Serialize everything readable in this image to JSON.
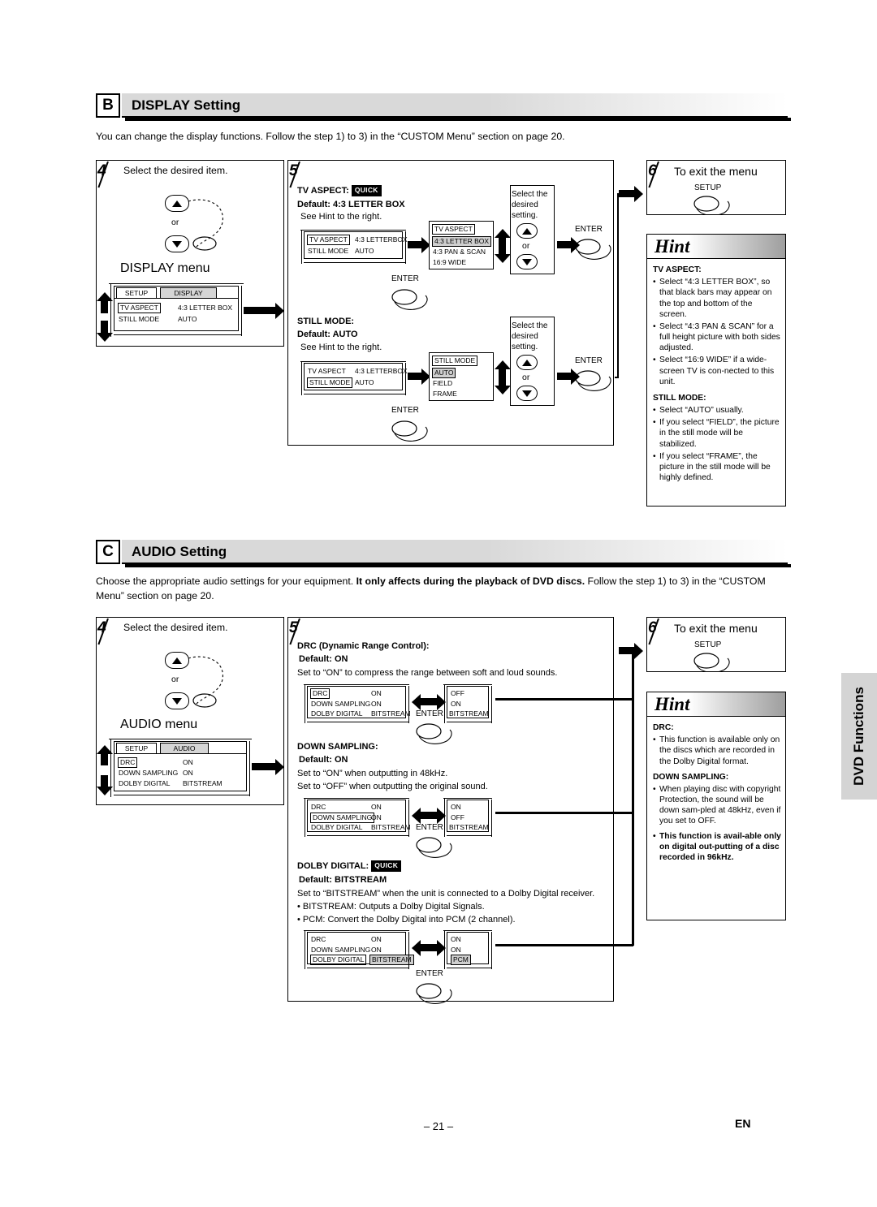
{
  "page": {
    "number": "– 21 –",
    "lang": "EN",
    "side_tab": "DVD Functions"
  },
  "sections": [
    {
      "letter": "B",
      "title": "DISPLAY Setting",
      "intro": "You can change the display functions. Follow the step 1) to 3) in the “CUSTOM Menu” section on page 20.",
      "step4": {
        "num": "4",
        "label": "Select the desired item.",
        "or": "or",
        "menu_label": "DISPLAY menu"
      },
      "step5": {
        "num": "5"
      },
      "step6": {
        "num": "6",
        "label": "To exit the menu",
        "setup": "SETUP"
      },
      "osd_main": {
        "tab_left": "SETUP",
        "tab_right": "DISPLAY",
        "rows": [
          {
            "name": "TV ASPECT",
            "value": "4:3 LETTER BOX"
          },
          {
            "name": "STILL MODE",
            "value": "AUTO"
          }
        ]
      },
      "items": [
        {
          "title": "TV ASPECT:",
          "quick": "QUICK",
          "default": "Default: 4:3 LETTER BOX",
          "note": "See Hint to the right.",
          "osd_before": {
            "rows": [
              {
                "name": "TV ASPECT",
                "value": "4:3 LETTERBOX"
              },
              {
                "name": "STILL MODE",
                "value": "AUTO"
              }
            ]
          },
          "enter": "ENTER",
          "select_note": "Select the desired setting.",
          "options": [
            "TV ASPECT",
            "4:3 LETTER BOX",
            "4:3 PAN & SCAN",
            "16:9 WIDE"
          ],
          "or": "or",
          "enter2": "ENTER"
        },
        {
          "title": "STILL MODE:",
          "quick": "",
          "default": "Default: AUTO",
          "note": "See Hint to the right.",
          "osd_before": {
            "rows": [
              {
                "name": "TV ASPECT",
                "value": "4:3 LETTERBOX"
              },
              {
                "name": "STILL MODE",
                "value": "AUTO"
              }
            ]
          },
          "enter": "ENTER",
          "select_note": "Select the desired setting.",
          "options": [
            "STILL MODE",
            "AUTO",
            "FIELD",
            "FRAME"
          ],
          "or": "or",
          "enter2": "ENTER"
        }
      ],
      "hint": {
        "word": "Hint",
        "groups": [
          {
            "head": "TV ASPECT:",
            "bullets": [
              "Select “4:3 LETTER BOX”, so that black bars may appear on the top and bottom of the screen.",
              "Select “4:3 PAN & SCAN” for a full height picture with both sides adjusted.",
              "Select “16:9 WIDE” if a wide-screen TV is con-nected to this unit."
            ]
          },
          {
            "head": "STILL MODE:",
            "bullets": [
              "Select “AUTO” usually.",
              "If you select “FIELD”, the picture in the still mode will be stabilized.",
              "If you select “FRAME”, the picture in the still mode will be highly defined."
            ]
          }
        ]
      }
    },
    {
      "letter": "C",
      "title": "AUDIO Setting",
      "intro_pre": "Choose the appropriate audio settings for your equipment. ",
      "intro_bold": "It only affects during the playback of DVD discs.",
      "intro_post": " Follow the step 1) to 3) in the “CUSTOM Menu” section on page 20.",
      "step4": {
        "num": "4",
        "label": "Select the desired item.",
        "or": "or",
        "menu_label": "AUDIO menu"
      },
      "step5": {
        "num": "5"
      },
      "step6": {
        "num": "6",
        "label": "To exit the menu",
        "setup": "SETUP"
      },
      "osd_main": {
        "tab_left": "SETUP",
        "tab_right": "AUDIO",
        "rows": [
          {
            "name": "DRC",
            "value": "ON"
          },
          {
            "name": "DOWN SAMPLING",
            "value": "ON"
          },
          {
            "name": "DOLBY DIGITAL",
            "value": "BITSTREAM"
          }
        ]
      },
      "items": [
        {
          "title": "DRC (Dynamic Range Control):",
          "quick": "",
          "default": "Default: ON",
          "desc": [
            "Set to “ON” to compress the range between soft and loud sounds."
          ],
          "osd_left": {
            "rows": [
              {
                "name": "DRC",
                "value": "ON"
              },
              {
                "name": "DOWN SAMPLING",
                "value": "ON"
              },
              {
                "name": "DOLBY DIGITAL",
                "value": "BITSTREAM"
              }
            ]
          },
          "osd_right": {
            "rows": [
              {
                "name": "",
                "value": "OFF"
              },
              {
                "name": "",
                "value": "ON"
              },
              {
                "name": "",
                "value": "BITSTREAM"
              }
            ]
          },
          "enter": "ENTER"
        },
        {
          "title": "DOWN SAMPLING:",
          "quick": "",
          "default": "Default: ON",
          "desc": [
            "Set to “ON” when outputting in 48kHz.",
            "Set to “OFF” when outputting the original sound."
          ],
          "osd_left": {
            "rows": [
              {
                "name": "DRC",
                "value": "ON"
              },
              {
                "name": "DOWN SAMPLING",
                "value": "ON"
              },
              {
                "name": "DOLBY DIGITAL",
                "value": "BITSTREAM"
              }
            ]
          },
          "osd_right": {
            "rows": [
              {
                "name": "",
                "value": "ON"
              },
              {
                "name": "",
                "value": "OFF"
              },
              {
                "name": "",
                "value": "BITSTREAM"
              }
            ]
          },
          "enter": "ENTER"
        },
        {
          "title": "DOLBY DIGITAL:",
          "quick": "QUICK",
          "default": "Default: BITSTREAM",
          "desc": [
            "Set to “BITSTREAM” when the unit is connected to a Dolby Digital receiver.",
            "• BITSTREAM: Outputs a Dolby Digital Signals.",
            "• PCM: Convert the Dolby Digital into PCM (2 channel)."
          ],
          "osd_left": {
            "rows": [
              {
                "name": "DRC",
                "value": "ON"
              },
              {
                "name": "DOWN SAMPLING",
                "value": "ON"
              },
              {
                "name": "DOLBY DIGITAL",
                "value": "BITSTREAM"
              }
            ]
          },
          "osd_right": {
            "rows": [
              {
                "name": "",
                "value": "ON"
              },
              {
                "name": "",
                "value": "ON"
              },
              {
                "name": "",
                "value": "PCM"
              }
            ]
          },
          "enter": "ENTER"
        }
      ],
      "hint": {
        "word": "Hint",
        "groups": [
          {
            "head": "DRC:",
            "bullets": [
              "This function is available only on the discs which are recorded in the Dolby Digital format."
            ]
          },
          {
            "head": "DOWN SAMPLING:",
            "bullets": [
              "When playing disc with copyright Protection, the sound will be down sam-pled at 48kHz, even if you set to OFF."
            ],
            "bold_note": "This function is avail-able only on digital out-putting of a disc recorded in 96kHz."
          }
        ]
      }
    }
  ]
}
